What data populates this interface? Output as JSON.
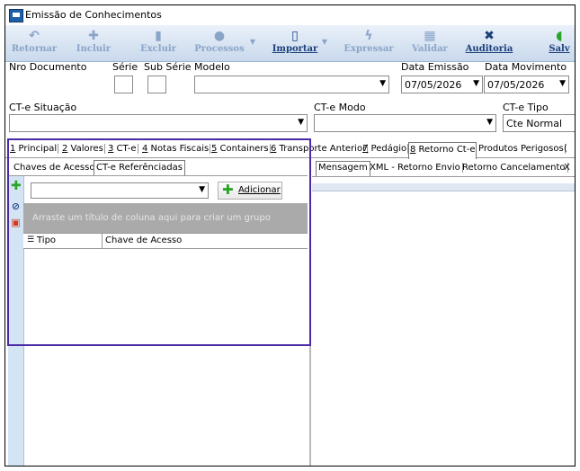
{
  "window": {
    "title": "Emissão de Conhecimentos"
  },
  "toolbar": {
    "items": [
      {
        "label": "Retornar",
        "icon": "undo-icon",
        "active": false
      },
      {
        "label": "Incluir",
        "icon": "plus-icon",
        "active": false
      },
      {
        "label": "Excluir",
        "icon": "trash-icon",
        "active": false
      },
      {
        "label": "Processos",
        "icon": "gear-icon",
        "active": false
      },
      {
        "label": "Importar",
        "icon": "document-icon",
        "active": true
      },
      {
        "label": "Expressar",
        "icon": "lightning-icon",
        "active": false
      },
      {
        "label": "Validar",
        "icon": "calculator-icon",
        "active": false
      },
      {
        "label": "Auditoria",
        "icon": "tools-icon",
        "active": true
      },
      {
        "label": "Salv",
        "icon": "save-icon",
        "active": true
      }
    ]
  },
  "fields": {
    "nro_documento": "Nro Documento",
    "serie": "Série",
    "sub_serie": "Sub Série",
    "modelo": "Modelo",
    "data_emissao_label": "Data Emissão",
    "data_emissao_value": "07/05/2026",
    "data_movimento_label": "Data Movimento",
    "data_movimento_value": "07/05/2026",
    "cte_situacao": "CT-e Situação",
    "cte_modo": "CT-e Modo",
    "cte_tipo_label": "CT-e Tipo",
    "cte_tipo_value": "Cte Normal"
  },
  "tabs": [
    {
      "key": "1",
      "rest": " Principal"
    },
    {
      "key": "2",
      "rest": " Valores"
    },
    {
      "key": "3",
      "rest": " CT-e"
    },
    {
      "key": "4",
      "rest": " Notas Fiscais"
    },
    {
      "key": "5",
      "rest": " Containers"
    },
    {
      "key": "6",
      "rest": " Transporte Anterior"
    },
    {
      "key": "7",
      "rest": " Pedágio"
    },
    {
      "key": "8",
      "rest": " Retorno Ct-e"
    },
    {
      "key": "",
      "rest": "Produtos Perigosos"
    },
    {
      "key": "",
      "rest": "("
    }
  ],
  "left_subtabs": [
    "Chaves de Acesso",
    "CT-e Referênciadas"
  ],
  "right_subtabs": [
    "Mensagem",
    "XML - Retorno Envio",
    "Retorno Cancelamento",
    "X"
  ],
  "add_button": "Adicionar",
  "group_hint": "Arraste um título de coluna aqui para criar um grupo",
  "grid_headers": [
    "Tipo",
    "Chave de Acesso"
  ],
  "colors": {
    "selection_border": "#4a2aa5",
    "toolbar_text": "#1b3f7a"
  }
}
